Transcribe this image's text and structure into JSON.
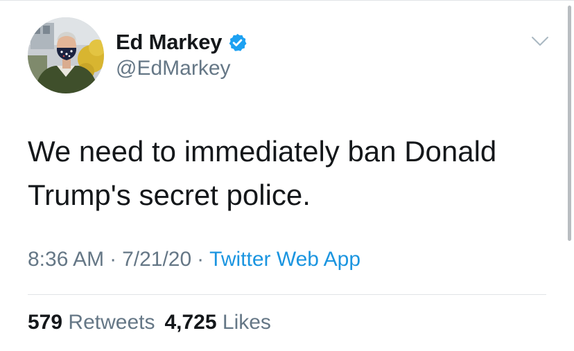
{
  "tweet": {
    "author": {
      "name": "Ed Markey",
      "handle": "@EdMarkey",
      "verified": true,
      "avatar_icon": "profile-photo"
    },
    "text": "We need to immediately ban Donald Trump's secret police.",
    "time": "8:36 AM",
    "date": "7/21/20",
    "separator": "·",
    "source": "Twitter Web App",
    "stats": {
      "retweets_count": "579",
      "retweets_label": "Retweets",
      "likes_count": "4,725",
      "likes_label": "Likes"
    }
  },
  "colors": {
    "text": "#14171a",
    "secondary": "#657786",
    "link": "#1b95e0",
    "verified": "#1da1f2",
    "divider": "#e1e4e6"
  }
}
